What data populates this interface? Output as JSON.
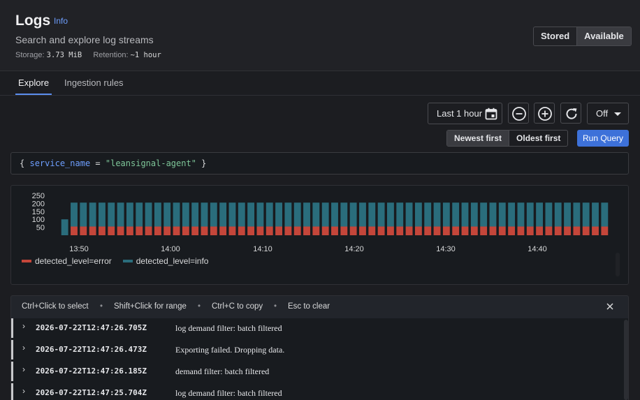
{
  "header": {
    "title": "Logs",
    "info_link": "Info",
    "subtitle": "Search and explore log streams",
    "storage_label": "Storage:",
    "storage_value": "3.73 MiB",
    "retention_label": "Retention:",
    "retention_value": "~1 hour",
    "mode_toggle": {
      "stored": "Stored",
      "available": "Available",
      "selected": "Available"
    }
  },
  "tabs": [
    {
      "label": "Explore",
      "active": true
    },
    {
      "label": "Ingestion rules",
      "active": false
    }
  ],
  "toolbar": {
    "time_range": "Last 1 hour",
    "calendar_icon": "calendar-icon",
    "zoom_out_icon": "zoom-out-icon",
    "zoom_in_icon": "zoom-in-icon",
    "refresh_icon": "refresh-icon",
    "refresh_interval": "Off",
    "order": {
      "newest": "Newest first",
      "oldest": "Oldest first",
      "selected": "Newest first"
    },
    "run_query": "Run Query"
  },
  "query": {
    "open": "{",
    "key": "service_name",
    "op": "=",
    "value": "\"leansignal-agent\"",
    "close": "}"
  },
  "chart_data": {
    "type": "bar",
    "stacked": true,
    "ylim": [
      0,
      250
    ],
    "yticks": [
      50,
      100,
      150,
      200,
      250
    ],
    "xticks": [
      "13:50",
      "14:00",
      "14:10",
      "14:20",
      "14:30",
      "14:40"
    ],
    "series": [
      {
        "name": "detected_level=error",
        "color": "#c4463a",
        "values": [
          0,
          55,
          55,
          55,
          55,
          55,
          55,
          55,
          55,
          55,
          55,
          55,
          55,
          55,
          55,
          55,
          55,
          55,
          55,
          55,
          55,
          55,
          55,
          55,
          55,
          55,
          55,
          55,
          55,
          55,
          55,
          55,
          55,
          55,
          55,
          55,
          55,
          55,
          55,
          55,
          55,
          55,
          55,
          55,
          55,
          55,
          55,
          55,
          55,
          55,
          55,
          55,
          55,
          55,
          55,
          55,
          55,
          55,
          55
        ]
      },
      {
        "name": "detected_level=info",
        "color": "#2a6d7c",
        "values": [
          100,
          150,
          150,
          150,
          150,
          150,
          150,
          150,
          150,
          150,
          150,
          150,
          150,
          150,
          150,
          150,
          150,
          150,
          150,
          150,
          150,
          150,
          150,
          150,
          150,
          150,
          150,
          150,
          150,
          150,
          150,
          150,
          150,
          150,
          150,
          150,
          150,
          150,
          150,
          150,
          150,
          150,
          150,
          150,
          150,
          150,
          150,
          150,
          150,
          150,
          150,
          150,
          150,
          150,
          150,
          150,
          150,
          150,
          150
        ]
      }
    ]
  },
  "hints": {
    "select": "Ctrl+Click to select",
    "range": "Shift+Click for range",
    "copy": "Ctrl+C to copy",
    "clear": "Esc to clear",
    "dot": "•",
    "close_icon": "close-icon"
  },
  "logs": [
    {
      "ts": "2026-07-22T12:47:26.705Z",
      "msg": "log demand filter: batch filtered"
    },
    {
      "ts": "2026-07-22T12:47:26.473Z",
      "msg": "Exporting failed. Dropping data."
    },
    {
      "ts": "2026-07-22T12:47:26.185Z",
      "msg": "demand filter: batch filtered"
    },
    {
      "ts": "2026-07-22T12:47:25.704Z",
      "msg": "log demand filter: batch filtered"
    }
  ]
}
